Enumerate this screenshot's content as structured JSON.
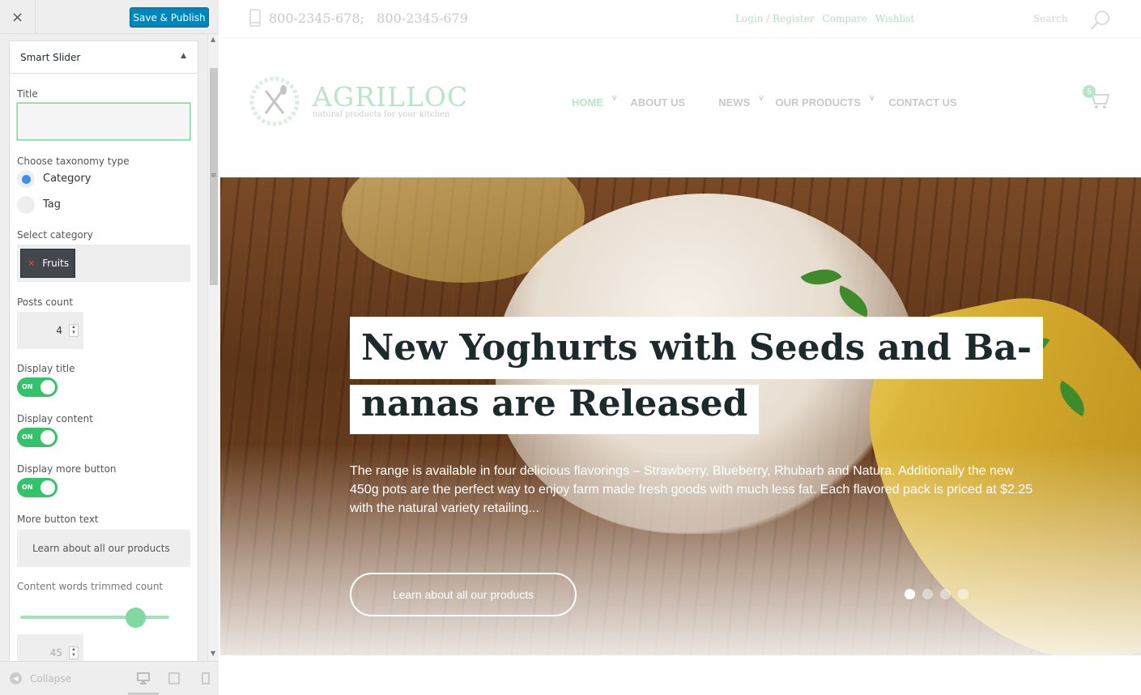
{
  "customizer": {
    "close_label": "×",
    "publish_label": "Save & Publish",
    "section_title": "Smart Slider",
    "title_label": "Title",
    "title_value": "",
    "taxonomy_label": "Choose taxonomy type",
    "taxonomy_options": [
      "Category",
      "Tag"
    ],
    "taxonomy_selected": "Category",
    "category_label": "Select category",
    "selected_category": "Fruits",
    "posts_count_label": "Posts count",
    "posts_count": "4",
    "display_title_label": "Display title",
    "display_content_label": "Display content",
    "display_more_label": "Display more button",
    "toggle_on": "ON",
    "more_text_label": "More button text",
    "more_text_value": "Learn about all our products",
    "trim_label": "Content words trimmed count",
    "trim_value": "45",
    "collapse_label": "Collapse"
  },
  "site": {
    "phones": "800-2345-678;   800-2345-679",
    "top_links": [
      "Login / Register",
      "Compare",
      "Wishlist"
    ],
    "search_placeholder": "Search",
    "logo_name": "AGRILLOC",
    "logo_tagline": "natural products for your kitchen",
    "nav": [
      {
        "label": "HOME",
        "dropdown": true
      },
      {
        "label": "ABOUT US",
        "dropdown": false
      },
      {
        "label": "NEWS",
        "dropdown": true
      },
      {
        "label": "OUR PRODUCTS",
        "dropdown": true
      },
      {
        "label": "CONTACT US",
        "dropdown": false
      }
    ],
    "cart_count": "5",
    "slide": {
      "title_line1": "New Yoghurts with Seeds and Ba-",
      "title_line2": "nanas are Released",
      "description": "The range is available in four delicious flavorings – Strawberry, Blueberry, Rhubarb and Natura. Additionally the new 450g pots are the perfect way to enjoy farm made fresh goods with much less fat. Each flavored pack is priced at $2.25 with the natural variety retailing...",
      "button": "Learn about all our products",
      "slide_count": 4,
      "active_slide": 1
    }
  },
  "colors": {
    "accent_green": "#34c36b",
    "publish_blue": "#0085ba",
    "radio_blue": "#3b8ee9"
  }
}
